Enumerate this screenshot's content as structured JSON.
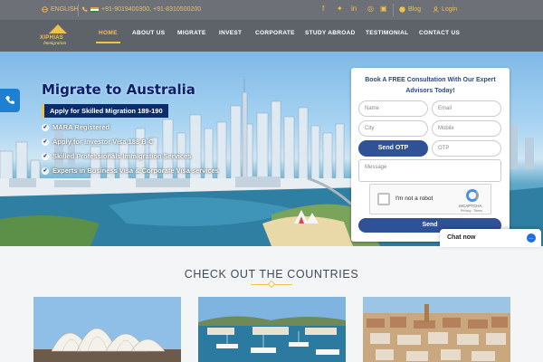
{
  "topbar": {
    "language": "ENGLISH",
    "phones": "+91-9019400300, +91-8310500200",
    "blog": "Blog",
    "login": "Login"
  },
  "logo": {
    "name": "XIPHIAS",
    "sub": "Immigration"
  },
  "nav": {
    "items": [
      "HOME",
      "ABOUT US",
      "MIGRATE",
      "INVEST",
      "CORPORATE",
      "STUDY ABROAD",
      "TESTIMONIAL",
      "CONTACT US"
    ]
  },
  "hero": {
    "title": "Migrate to Australia",
    "tagline": "Apply for Skilled Migration 189-190",
    "bullets": [
      "MARA Registered",
      "Apply for Investor Visa 188 B-C",
      "Skilled Professionals Immigration Services",
      "Experts in Business Visa & Corporate Visa services"
    ]
  },
  "form": {
    "title": "Book A FREE Consultation With Our Expert Advisors Today!",
    "name_placeholder": "Name",
    "email_placeholder": "Email",
    "city_placeholder": "City",
    "mobile_placeholder": "Mobile",
    "send_otp": "Send OTP",
    "otp_placeholder": "OTP",
    "message_placeholder": "Message",
    "captcha_label": "I'm not a robot",
    "captcha_brand": "reCAPTCHA",
    "captcha_terms": "Privacy - Terms",
    "send": "Send"
  },
  "chat": {
    "label": "Chat now"
  },
  "countries": {
    "title": "CHECK OUT THE COUNTRIES"
  },
  "colors": {
    "accent": "#f0c14b",
    "navy": "#0b2d6b",
    "button": "#2f5196"
  }
}
